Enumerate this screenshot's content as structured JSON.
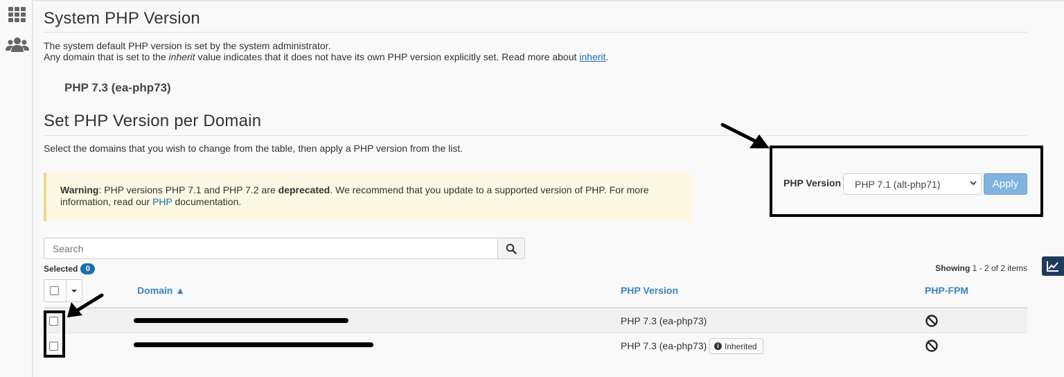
{
  "system": {
    "title": "System PHP Version",
    "desc_line1": "The system default PHP version is set by the system administrator.",
    "desc_line2_pre": "Any domain that is set to the ",
    "desc_line2_em": "inherit",
    "desc_line2_mid": " value indicates that it does not have its own PHP version explicitly set. Read more about ",
    "desc_line2_link": "inherit",
    "desc_line2_post": ".",
    "current_version": "PHP 7.3 (ea-php73)"
  },
  "per_domain": {
    "title": "Set PHP Version per Domain",
    "desc": "Select the domains that you wish to change from the table, then apply a PHP version from the list."
  },
  "warning": {
    "label": "Warning",
    "text1": ": PHP versions PHP 7.1 and PHP 7.2 are ",
    "bold": "deprecated",
    "text2": ". We recommend that you update to a supported version of PHP. For more information, read our ",
    "link": "PHP",
    "text3": " documentation."
  },
  "version_picker": {
    "label": "PHP Version",
    "selected": "PHP 7.1 (alt-php71)",
    "apply_label": "Apply"
  },
  "search": {
    "placeholder": "Search"
  },
  "selection": {
    "label": "Selected",
    "count": "0"
  },
  "pagination": {
    "prefix": "Showing",
    "range": " 1 - 2 of 2 items"
  },
  "table": {
    "columns": {
      "domain": "Domain ▲",
      "php_version": "PHP Version",
      "php_fpm": "PHP-FPM"
    },
    "rows": [
      {
        "domain": "",
        "php_version": "PHP 7.3 (ea-php73)",
        "inherited": ""
      },
      {
        "domain": "",
        "php_version": "PHP 7.3 (ea-php73)",
        "inherited": "Inherited"
      }
    ]
  },
  "icons": {
    "rail_top": "grid-icon",
    "rail_second": "users-icon",
    "search": "search-icon",
    "fpm": "disabled-icon",
    "info": "info-icon",
    "stats": "chart-line-icon"
  },
  "colors": {
    "accent": "#1a6fb0",
    "header_link": "#3a84bf",
    "apply_bg": "#7fb3e0",
    "warning_bg": "#fcf8e3"
  }
}
